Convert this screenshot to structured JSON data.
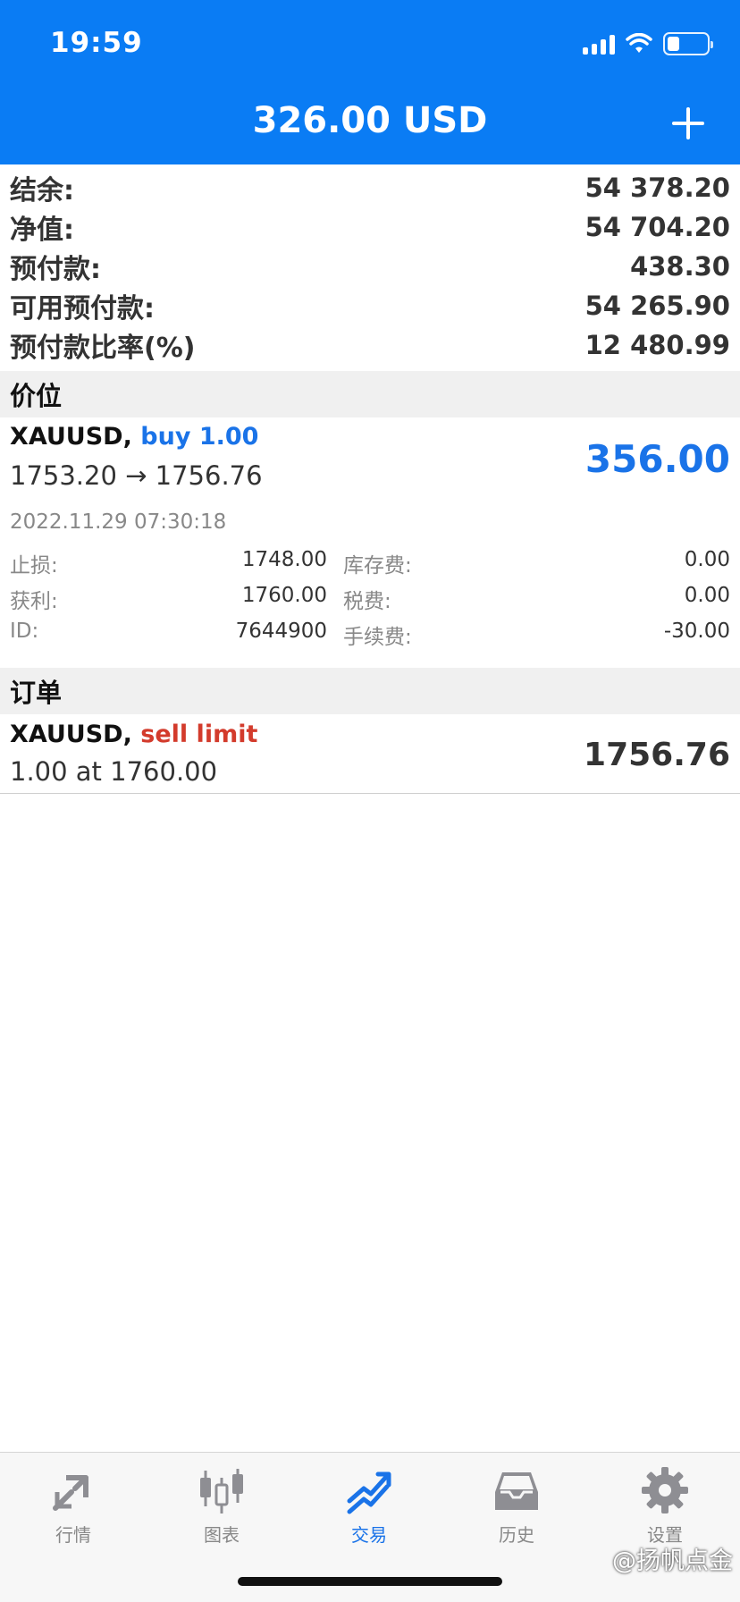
{
  "status_bar": {
    "time": "19:59"
  },
  "header": {
    "title": "326.00 USD"
  },
  "summary": [
    {
      "label": "结余:",
      "value": "54 378.20"
    },
    {
      "label": "净值:",
      "value": "54 704.20"
    },
    {
      "label": "预付款:",
      "value": "438.30"
    },
    {
      "label": "可用预付款:",
      "value": "54 265.90"
    },
    {
      "label": "预付款比率(%)",
      "value": "12 480.99"
    }
  ],
  "positions_section": {
    "title": "价位"
  },
  "position": {
    "symbol": "XAUUSD,",
    "side": "buy 1.00",
    "prices": "1753.20 → 1756.76",
    "profit": "356.00",
    "time": "2022.11.29 07:30:18",
    "details": {
      "sl_label": "止损:",
      "sl_value": "1748.00",
      "tp_label": "获利:",
      "tp_value": "1760.00",
      "id_label": "ID:",
      "id_value": "7644900",
      "swap_label": "库存费:",
      "swap_value": "0.00",
      "tax_label": "税费:",
      "tax_value": "0.00",
      "fee_label": "手续费:",
      "fee_value": "-30.00"
    }
  },
  "orders_section": {
    "title": "订单"
  },
  "order": {
    "symbol": "XAUUSD,",
    "type": "sell limit",
    "desc": "1.00 at 1760.00",
    "price": "1756.76"
  },
  "tabs": [
    {
      "label": "行情",
      "icon": "quotes-icon"
    },
    {
      "label": "图表",
      "icon": "chart-icon"
    },
    {
      "label": "交易",
      "icon": "trade-icon"
    },
    {
      "label": "历史",
      "icon": "history-icon"
    },
    {
      "label": "设置",
      "icon": "settings-icon"
    }
  ],
  "watermark": "@扬帆点金",
  "colors": {
    "header": "#0a7cf4",
    "buy": "#1a73e8",
    "sell": "#d33b2c"
  }
}
